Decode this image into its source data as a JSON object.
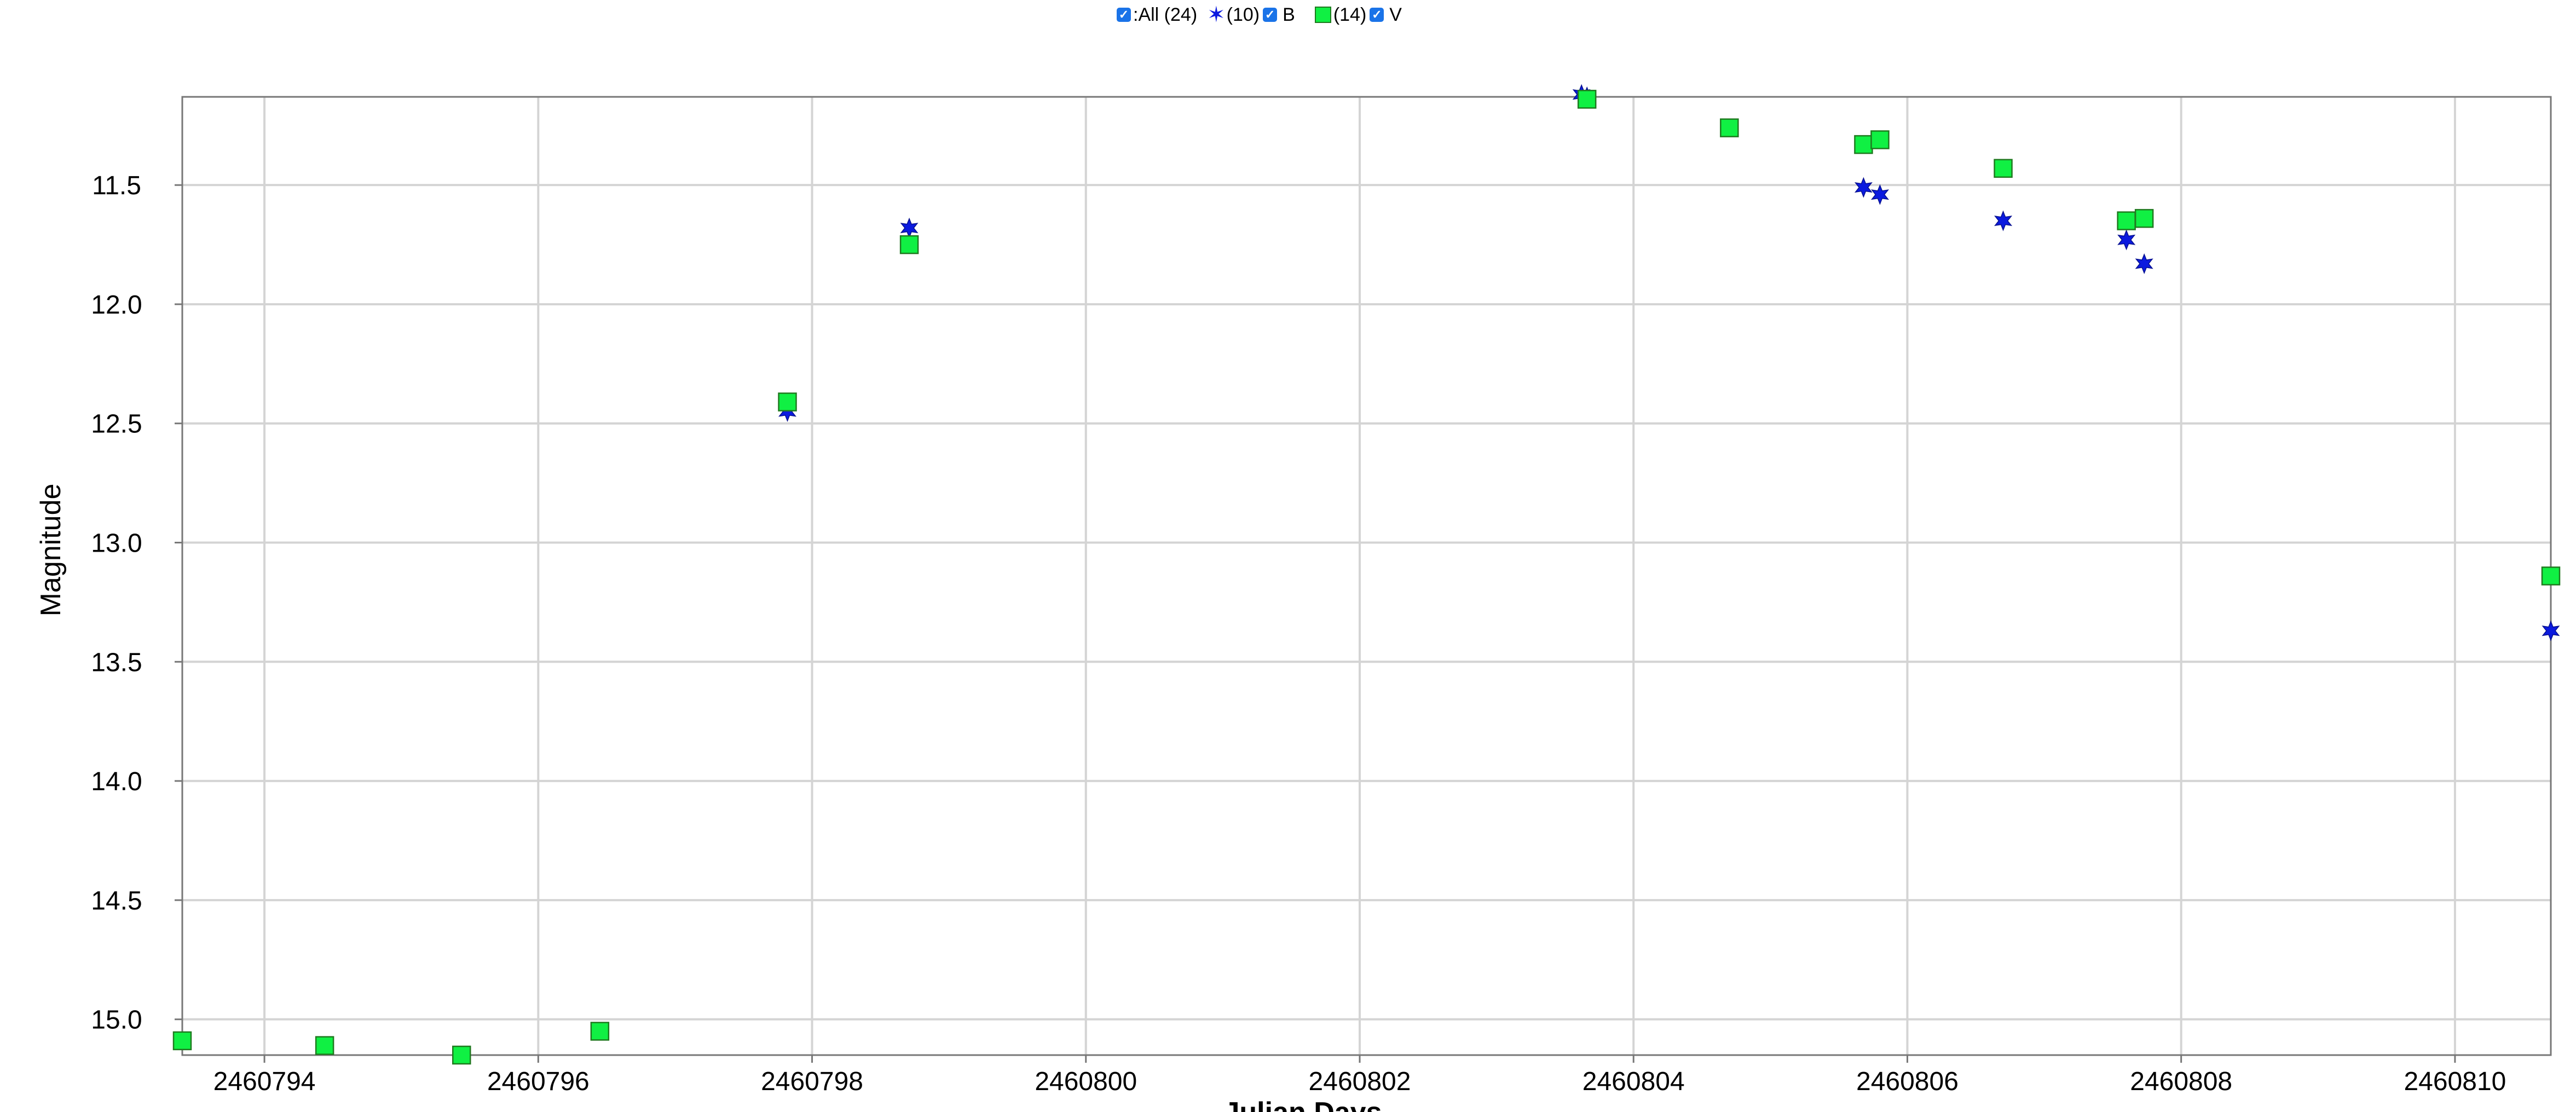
{
  "legend": {
    "all_label": ":All (24)",
    "b_count": "(10)",
    "b_label": "B",
    "v_count": "(14)",
    "v_label": "V"
  },
  "colors": {
    "B": "#0b1adf",
    "V": "#10f043",
    "V_border": "#1f7a1f",
    "grid": "#d4d4d4",
    "checkbox": "#1a73e8"
  },
  "chart_data": {
    "type": "scatter",
    "xlabel": "Julian Days",
    "ylabel": "Magnitude",
    "xlim": [
      2460793.4,
      2460810.7
    ],
    "ylim": [
      15.15,
      11.13
    ],
    "y_inverted": true,
    "grid": true,
    "legend_position": "top-center",
    "x_ticks": [
      2460794,
      2460796,
      2460798,
      2460800,
      2460802,
      2460804,
      2460806,
      2460808,
      2460810
    ],
    "y_ticks": [
      11.5,
      12.0,
      12.5,
      13.0,
      13.5,
      14.0,
      14.5,
      15.0
    ],
    "y_tick_labels": [
      "11.5",
      "12.0",
      "12.5",
      "13.0",
      "13.5",
      "14.0",
      "14.5",
      "15.0"
    ],
    "series": [
      {
        "name": "B",
        "marker": "star",
        "points": [
          [
            2460797.82,
            12.45
          ],
          [
            2460798.71,
            11.68
          ],
          [
            2460803.66,
            11.13
          ],
          [
            2460805.68,
            11.51
          ],
          [
            2460805.8,
            11.54
          ],
          [
            2460806.7,
            11.65
          ],
          [
            2460807.6,
            11.73
          ],
          [
            2460807.73,
            11.83
          ],
          [
            2460810.7,
            13.37
          ],
          [
            2460803.62,
            11.12
          ]
        ]
      },
      {
        "name": "V",
        "marker": "square",
        "points": [
          [
            2460793.4,
            15.09
          ],
          [
            2460794.44,
            15.11
          ],
          [
            2460795.44,
            15.15
          ],
          [
            2460796.45,
            15.05
          ],
          [
            2460797.82,
            12.41
          ],
          [
            2460798.71,
            11.75
          ],
          [
            2460803.66,
            11.14
          ],
          [
            2460804.7,
            11.26
          ],
          [
            2460805.68,
            11.33
          ],
          [
            2460805.8,
            11.31
          ],
          [
            2460806.7,
            11.43
          ],
          [
            2460807.6,
            11.65
          ],
          [
            2460807.73,
            11.64
          ],
          [
            2460810.7,
            13.14
          ]
        ]
      }
    ]
  }
}
